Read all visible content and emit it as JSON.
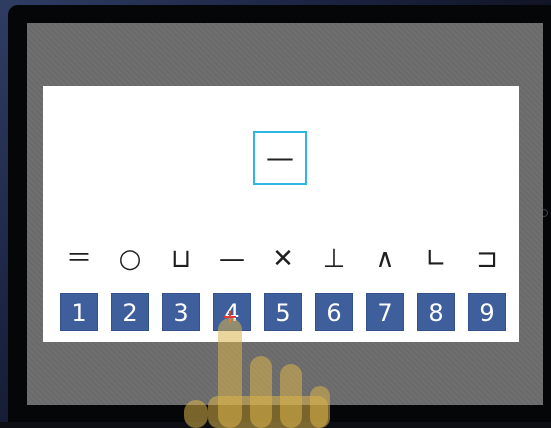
{
  "task": {
    "target_symbol": "—"
  },
  "symbol_row": [
    "＝",
    "○",
    "⊔",
    "—",
    "✕",
    "⊥",
    "∧",
    "∟",
    "⊐"
  ],
  "number_keys": [
    "1",
    "2",
    "3",
    "4",
    "5",
    "6",
    "7",
    "8",
    "9"
  ],
  "colors": {
    "key_background": "#3f5f9c",
    "target_border": "#2eb7e6",
    "screen_background": "#6c6c6c",
    "hand_overlay": "#d8b24a"
  },
  "icons": {
    "pointer": "hand-pointer-icon",
    "crosshair": "crosshair-icon"
  }
}
